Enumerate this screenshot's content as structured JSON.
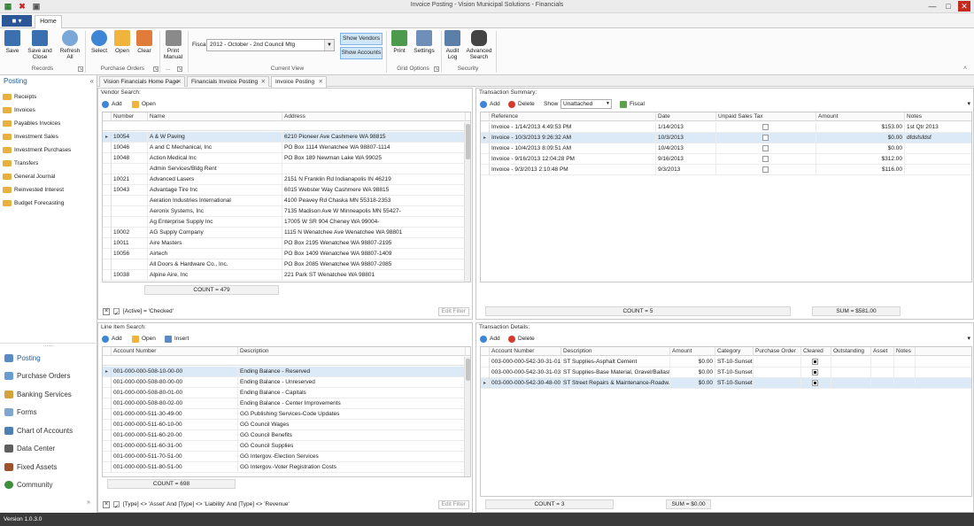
{
  "app": {
    "title": "Invoice Posting - Vision Municipal Solutions - Financials",
    "version": "Version 1.0.3.0"
  },
  "ribbon": {
    "home_tab": "Home",
    "buttons": {
      "save": "Save",
      "save_close": "Save and Close",
      "refresh_all": "Refresh All",
      "select": "Select",
      "open": "Open",
      "clear": "Clear",
      "print_manual": "Print Manual",
      "print": "Print",
      "settings": "Settings",
      "audit_log": "Audit Log",
      "advanced_search": "Advanced Search"
    },
    "groups": {
      "records": "Records",
      "purchase_orders": "Purchase Orders",
      "more": "...",
      "current_view": "Current View",
      "grid_options": "Grid Options",
      "security": "Security"
    },
    "fiscal_label": "Fiscal",
    "fiscal_value": "2012 - October - 2nd Council Mtg",
    "show_vendors": "Show Vendors",
    "show_accounts": "Show Accounts"
  },
  "sidebar": {
    "title": "Posting",
    "items": [
      "Receipts",
      "Invoices",
      "Payables Invoices",
      "Investment Sales",
      "Investment Purchases",
      "Transfers",
      "General Journal",
      "Reinvested Interest",
      "Budget Forecasting"
    ],
    "nav": [
      "Posting",
      "Purchase Orders",
      "Banking Services",
      "Forms",
      "Chart of Accounts",
      "Data Center",
      "Fixed Assets",
      "Community"
    ]
  },
  "doc_tabs": [
    "Vision Financials Home Page",
    "Financials Invoice Posting",
    "Invoice Posting"
  ],
  "vendor_search": {
    "title": "Vendor Search:",
    "add": "Add",
    "open": "Open",
    "columns": [
      "Number",
      "Name",
      "Address"
    ],
    "rows": [
      [
        "10054",
        "A & W Paving",
        "6210 Pioneer Ave Cashmere WA 98815"
      ],
      [
        "10046",
        "A and C Mechanical, Inc",
        "PO Box 1114 Wenatchee WA 98807-1114"
      ],
      [
        "10048",
        "Action Medical Inc",
        "PO Box 189 Newman Lake WA 99025"
      ],
      [
        "",
        "Admin Services/Bldg Rent",
        ""
      ],
      [
        "10021",
        "Advanced Lasers",
        "2151 N Franklin Rd  Indianapolis IN 46219"
      ],
      [
        "10043",
        "Advantage Tire Inc",
        "6015 Webster Way Cashmere WA 98815"
      ],
      [
        "",
        "Aeration Industries International",
        "4100 Peavey Rd Chaska MN 55318-2353"
      ],
      [
        "",
        "Aeronix Systems, Inc",
        "7135 Madison Ave W Minneapolis MN 55427-"
      ],
      [
        "",
        "Ag Enterprise Supply Inc",
        "17005 W SR 904 Cheney WA 99004-"
      ],
      [
        "10002",
        "AG Supply Company",
        "1115 N Wenatchee Ave Wenatchee WA 98801"
      ],
      [
        "10011",
        "Aire Masters",
        "PO Box 2195 Wenatchee WA 98807-2195"
      ],
      [
        "10056",
        "Airtech",
        "PO Box 1409 Wenatchee WA 98807-1409"
      ],
      [
        "",
        "All Doors & Hardware Co., Inc.",
        "PO Box 2085 Wenatchee WA 98807-2085"
      ],
      [
        "10038",
        "Alpine Aire, Inc",
        "221 Park ST Wenatchee WA 98801"
      ]
    ],
    "count": "COUNT = 479",
    "filter": "[Active] = 'Checked'",
    "edit_filter": "Edit Filter"
  },
  "line_item_search": {
    "title": "Line Item Search:",
    "add": "Add",
    "open": "Open",
    "insert": "Insert",
    "columns": [
      "Account Number",
      "Description"
    ],
    "rows": [
      [
        "001-000-000-508-10-00-00",
        "Ending Balance - Reserved"
      ],
      [
        "001-000-000-508-80-00-00",
        "Ending Balance - Unreserved"
      ],
      [
        "001-000-000-508-80-01-00",
        "Ending Balance - Capitals"
      ],
      [
        "001-000-000-508-80-02-00",
        "Ending Balance - Center Improvements"
      ],
      [
        "001-000-000-511-30-49-00",
        "GG Publishing Services-Code Updates"
      ],
      [
        "001-000-000-511-60-10-00",
        "GG Council Wages"
      ],
      [
        "001-000-000-511-60-20-00",
        "GG Council Benefits"
      ],
      [
        "001-000-000-511-60-31-00",
        "GG Council Supplies"
      ],
      [
        "001-000-000-511-70-51-00",
        "GG Intergov.-Election Services"
      ],
      [
        "001-000-000-511-80-51-00",
        "GG Intergov.-Voter Registration Costs"
      ]
    ],
    "count": "COUNT = 698",
    "filter": "[Type] <> 'Asset' And [Type] <> 'Liability' And [Type] <> 'Revenue'",
    "edit_filter": "Edit Filter"
  },
  "transaction_summary": {
    "title": "Transaction Summary:",
    "add": "Add",
    "delete": "Delete",
    "show_label": "Show",
    "show_value": "Unattached",
    "fiscal": "Fiscal",
    "columns": [
      "Reference",
      "Date",
      "Unpaid Sales Tax",
      "Amount",
      "Notes"
    ],
    "rows": [
      [
        "Invoice - 1/14/2013 4:49:53 PM",
        "1/14/2013",
        "",
        "$153.00",
        "1st Qtr 2013"
      ],
      [
        "Invoice - 10/3/2013 9:26:32 AM",
        "10/3/2013",
        "",
        "$0.00",
        "dfdsfsfdsf"
      ],
      [
        "Invoice - 10/4/2013 8:09:51 AM",
        "10/4/2013",
        "",
        "$0.00",
        ""
      ],
      [
        "Invoice - 9/16/2013 12:04:28 PM",
        "9/16/2013",
        "",
        "$312.00",
        ""
      ],
      [
        "Invoice - 9/3/2013 2:10:48 PM",
        "9/3/2013",
        "",
        "$116.00",
        ""
      ]
    ],
    "count": "COUNT = 5",
    "sum": "SUM = $581.00"
  },
  "transaction_details": {
    "title": "Transaction Details:",
    "add": "Add",
    "delete": "Delete",
    "columns": [
      "Account Number",
      "Description",
      "Amount",
      "Category",
      "Purchase Order",
      "Cleared",
      "Outstanding",
      "Asset",
      "Notes"
    ],
    "rows": [
      [
        "003-000-000-542-30-31-01",
        "ST Supplies-Asphalt Cement",
        "$0.00",
        "ST-10-Sunset"
      ],
      [
        "003-000-000-542-30-31-03",
        "ST Supplies-Base Material, Gravel/Ballast",
        "$0.00",
        "ST-10-Sunset"
      ],
      [
        "003-000-000-542-30-48-00",
        "ST Street Repairs & Maintenance-Roadw...",
        "$0.00",
        "ST-10-Sunset"
      ]
    ],
    "count": "COUNT = 3",
    "sum": "SUM = $0.00"
  }
}
